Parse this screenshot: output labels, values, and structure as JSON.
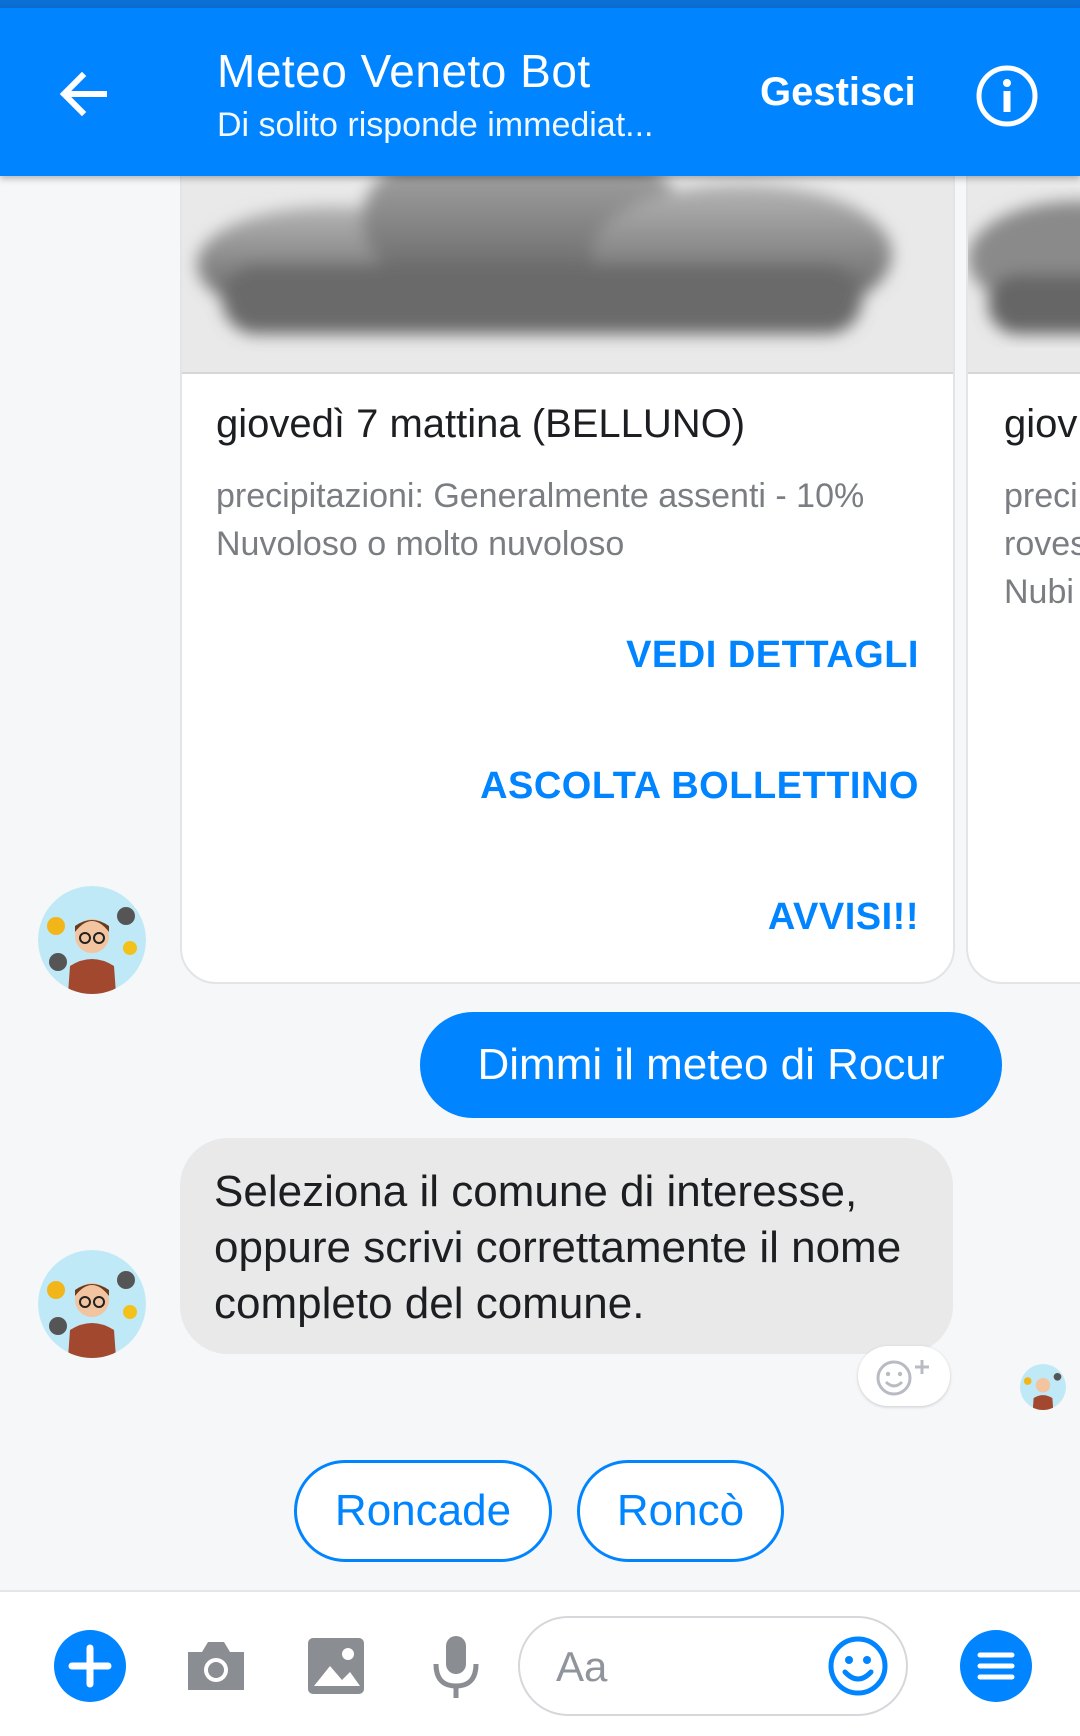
{
  "header": {
    "title": "Meteo Veneto Bot",
    "subtitle": "Di solito risponde immediat...",
    "manage_label": "Gestisci"
  },
  "cards": [
    {
      "title": "giovedì 7 mattina (BELLUNO)",
      "lines": [
        "precipitazioni: Generalmente assenti - 10%",
        "Nuvoloso o molto nuvoloso"
      ],
      "buttons": [
        "VEDI DETTAGLI",
        "ASCOLTA BOLLETTINO",
        "AVVISI!!"
      ]
    },
    {
      "title": "giov",
      "lines": [
        "preci",
        "roves",
        "Nubi"
      ]
    }
  ],
  "messages": {
    "outgoing": "Dimmi il meteo di Rocur",
    "incoming": "Seleziona il comune di interesse, oppure scrivi correttamente il nome completo del comune."
  },
  "quick_replies": [
    "Roncade",
    "Roncò"
  ],
  "composer": {
    "placeholder": "Aa"
  },
  "colors": {
    "accent": "#0084ff",
    "bubble_in": "#e9e9ea"
  }
}
